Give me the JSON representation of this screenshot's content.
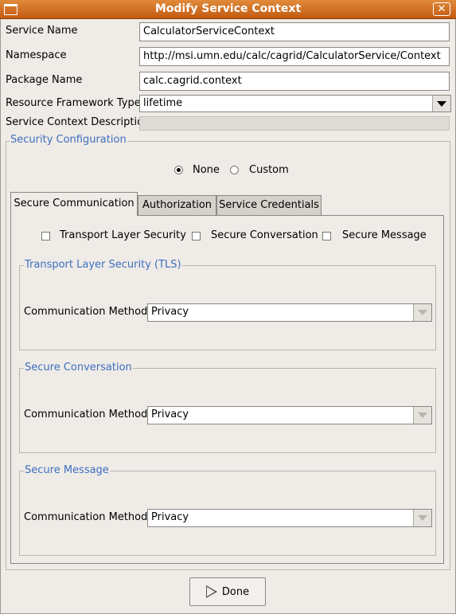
{
  "window": {
    "title": "Modify Service Context",
    "close_label": "✕"
  },
  "form": {
    "service_name": {
      "label": "Service Name",
      "value": "CalculatorServiceContext"
    },
    "namespace": {
      "label": "Namespace",
      "value": "http://msi.umn.edu/calc/cagrid/CalculatorService/Context"
    },
    "package_name": {
      "label": "Package Name",
      "value": "calc.cagrid.context"
    },
    "resource_framework": {
      "label": "Resource Framework Type",
      "value": "lifetime"
    },
    "description": {
      "label": "Service Context Description",
      "value": ""
    }
  },
  "security": {
    "title": "Security Configuration",
    "mode_options": [
      {
        "label": "None",
        "selected": true
      },
      {
        "label": "Custom",
        "selected": false
      }
    ],
    "tabs": [
      {
        "label": "Secure Communication",
        "active": true
      },
      {
        "label": "Authorization",
        "active": false
      },
      {
        "label": "Service Credentials",
        "active": false
      }
    ],
    "checkboxes": [
      {
        "label": "Transport Layer Security",
        "checked": false
      },
      {
        "label": "Secure Conversation",
        "checked": false
      },
      {
        "label": "Secure Message",
        "checked": false
      }
    ],
    "groups": [
      {
        "title": "Transport Layer Security (TLS)",
        "method_label": "Communication Method",
        "method_value": "Privacy"
      },
      {
        "title": "Secure Conversation",
        "method_label": "Communication Method",
        "method_value": "Privacy"
      },
      {
        "title": "Secure Message",
        "method_label": "Communication Method",
        "method_value": "Privacy"
      }
    ]
  },
  "footer": {
    "done_label": "Done"
  },
  "colors": {
    "titlebar": "#d9742a",
    "group_title": "#3d6fbf",
    "background": "#efebe7"
  },
  "icons": {
    "window_menu": "window-menu-icon",
    "close": "close-icon",
    "dropdown": "chevron-down-icon",
    "done": "play-icon"
  }
}
